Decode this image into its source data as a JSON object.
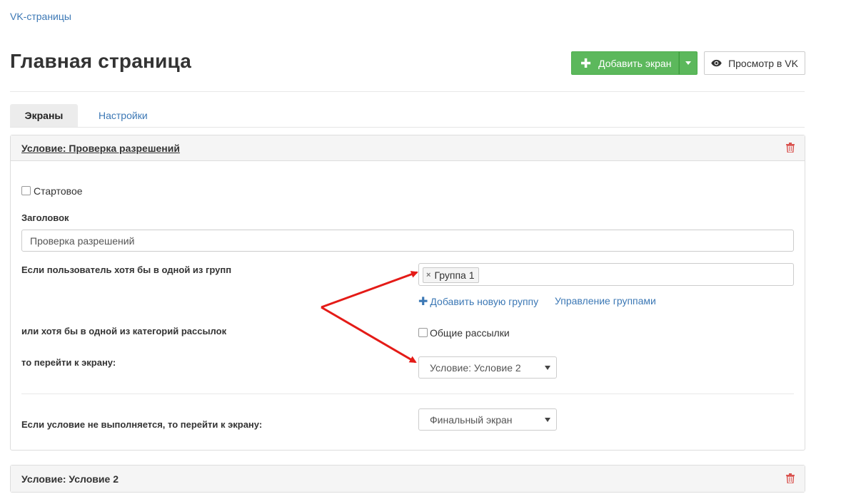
{
  "breadcrumb": "VK-страницы",
  "page_title": "Главная страница",
  "header_buttons": {
    "add_screen": "Добавить экран",
    "view_vk": "Просмотр в VK"
  },
  "tabs": [
    {
      "label": "Экраны",
      "active": true
    },
    {
      "label": "Настройки",
      "active": false
    }
  ],
  "panels": [
    {
      "title": "Условие: Проверка разрешений",
      "start_checkbox_label": "Стартовое",
      "start_checked": false,
      "heading_label": "Заголовок",
      "heading_value": "Проверка разрешений",
      "groups_label": "Если пользователь хотя бы в одной из групп",
      "group_tags": [
        "Группа 1"
      ],
      "add_group_link": "Добавить новую группу",
      "manage_groups_link": "Управление группами",
      "categories_label": "или хотя бы в одной из категорий рассылок",
      "category_checkbox_label": "Общие рассылки",
      "category_checked": false,
      "goto_label": "то перейти к экрану:",
      "goto_value": "Условие: Условие 2",
      "else_label": "Если условие не выполняется, то перейти к экрану:",
      "else_value": "Финальный экран"
    },
    {
      "title": "Условие: Условие 2"
    }
  ],
  "colors": {
    "primary_green": "#5cb85c",
    "link_blue": "#3c78b5",
    "danger_red": "#d9534f",
    "annotation_red": "#e41b17"
  }
}
